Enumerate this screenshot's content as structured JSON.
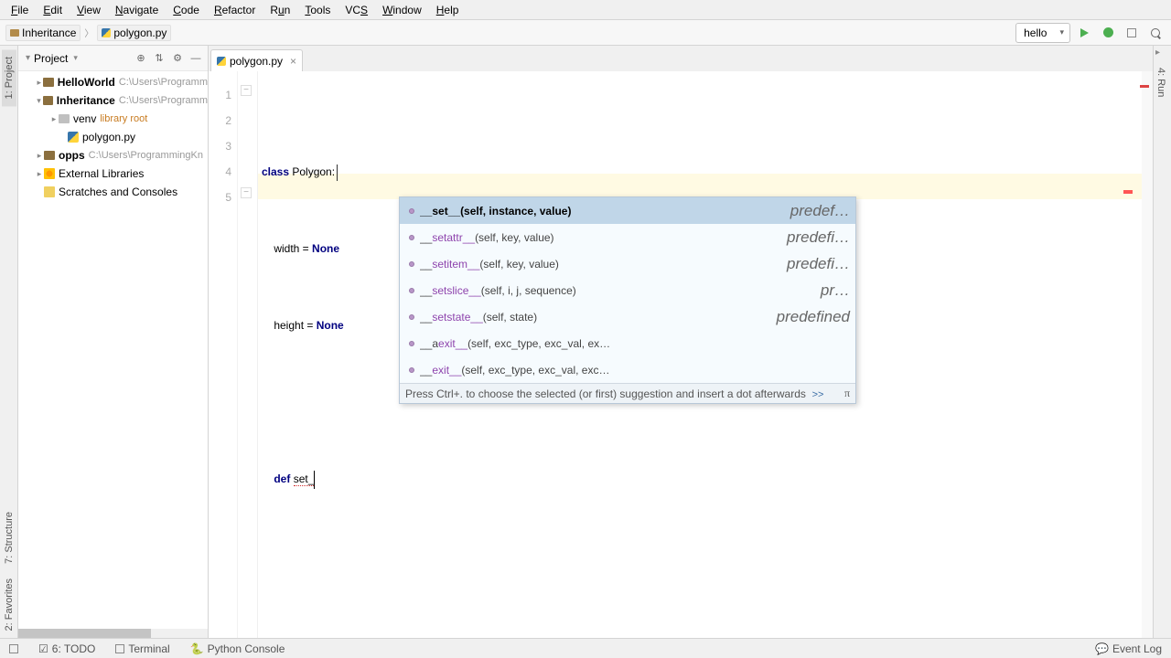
{
  "menu": [
    "File",
    "Edit",
    "View",
    "Navigate",
    "Code",
    "Refactor",
    "Run",
    "Tools",
    "VCS",
    "Window",
    "Help"
  ],
  "breadcrumb": {
    "project": "Inheritance",
    "file": "polygon.py"
  },
  "run_config": {
    "name": "hello"
  },
  "project_panel": {
    "title": "Project",
    "nodes": {
      "hello": {
        "name": "HelloWorld",
        "path": "C:\\Users\\Programm"
      },
      "inheritance": {
        "name": "Inheritance",
        "path": "C:\\Users\\Programm"
      },
      "venv": {
        "name": "venv",
        "tag": "library root"
      },
      "polygon": {
        "name": "polygon.py"
      },
      "opps": {
        "name": "opps",
        "path": "C:\\Users\\ProgrammingKn"
      },
      "ext": {
        "name": "External Libraries"
      },
      "scratch": {
        "name": "Scratches and Consoles"
      }
    }
  },
  "editor": {
    "tab": {
      "name": "polygon.py"
    },
    "gutter": [
      "1",
      "2",
      "3",
      "4",
      "5"
    ],
    "code": {
      "l1_kw": "class",
      "l1_rest": " Polygon:",
      "l2_a": "    width = ",
      "l2_kw": "None",
      "l3_a": "    height = ",
      "l3_kw": "None",
      "l5_a": "    ",
      "l5_kw": "def",
      "l5_b": " ",
      "l5_name": "set_"
    }
  },
  "autocomplete": {
    "items": [
      {
        "pre": "__",
        "match": "set",
        "post": "__",
        "args": "(self, instance, value)",
        "hint": "predef…",
        "selected": true
      },
      {
        "pre": "__",
        "match": "set",
        "post": "attr__",
        "args": "(self, key, value)",
        "hint": "predefi…"
      },
      {
        "pre": "__",
        "match": "set",
        "post": "item__",
        "args": "(self, key, value)",
        "hint": "predefi…"
      },
      {
        "pre": "__",
        "match": "set",
        "post": "slice__",
        "args": "(self, i, j, sequence)",
        "hint": "pr…"
      },
      {
        "pre": "__",
        "match": "set",
        "post": "state__",
        "args": "(self, state)",
        "hint": "predefined"
      },
      {
        "pre": "__a",
        "match": "",
        "post": "exit__",
        "args": "(self, exc_type, exc_val, ex…",
        "hint": ""
      },
      {
        "pre": "__",
        "match": "",
        "post": "exit__",
        "args": "(self, exc_type, exc_val, exc…",
        "hint": ""
      }
    ],
    "footer": "Press Ctrl+. to choose the selected (or first) suggestion and insert a dot afterwards",
    "more": ">>",
    "pi": "π"
  },
  "left_tabs": {
    "project": "1: Project",
    "structure": "7: Structure",
    "favorites": "2: Favorites"
  },
  "right_tab": "4: Run",
  "statusbar": {
    "todo": "6: TODO",
    "terminal": "Terminal",
    "console": "Python Console",
    "event": "Event Log"
  }
}
